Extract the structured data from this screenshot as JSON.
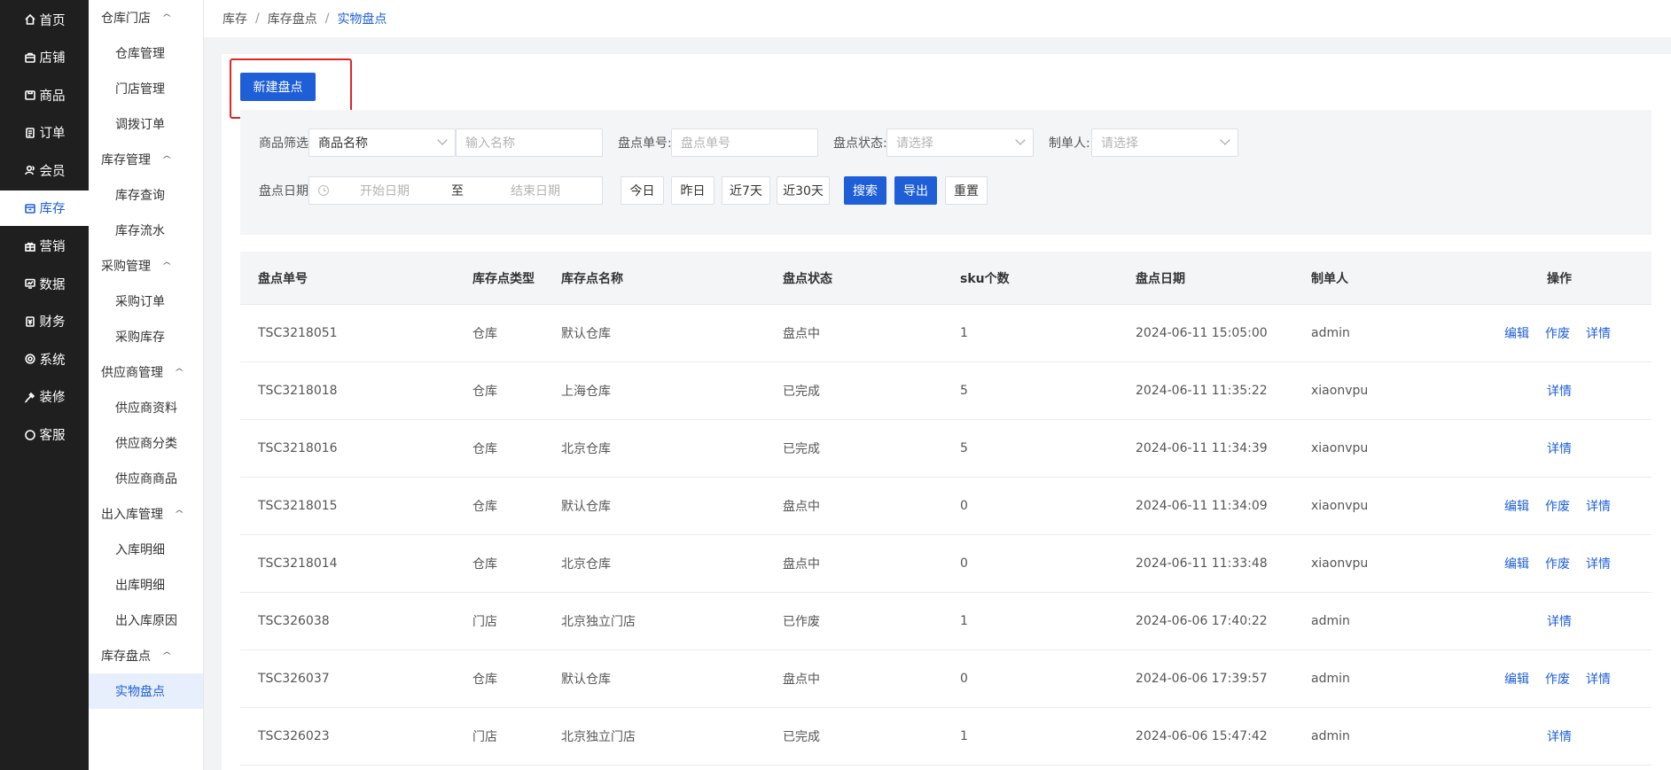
{
  "nav": [
    {
      "label": "首页",
      "icon": "home-icon"
    },
    {
      "label": "店铺",
      "icon": "store-icon"
    },
    {
      "label": "商品",
      "icon": "goods-icon"
    },
    {
      "label": "订单",
      "icon": "order-icon"
    },
    {
      "label": "会员",
      "icon": "member-icon"
    },
    {
      "label": "库存",
      "icon": "inventory-icon",
      "active": true
    },
    {
      "label": "营销",
      "icon": "gift-icon"
    },
    {
      "label": "数据",
      "icon": "chart-icon"
    },
    {
      "label": "财务",
      "icon": "finance-icon"
    },
    {
      "label": "系统",
      "icon": "gear-icon"
    },
    {
      "label": "装修",
      "icon": "decor-icon"
    },
    {
      "label": "客服",
      "icon": "chat-icon"
    }
  ],
  "submenu": [
    {
      "group": "仓库门店",
      "items": [
        "仓库管理",
        "门店管理",
        "调拨订单"
      ]
    },
    {
      "group": "库存管理",
      "items": [
        "库存查询",
        "库存流水"
      ]
    },
    {
      "group": "采购管理",
      "items": [
        "采购订单",
        "采购库存"
      ]
    },
    {
      "group": "供应商管理",
      "items": [
        "供应商资料",
        "供应商分类",
        "供应商商品"
      ]
    },
    {
      "group": "出入库管理",
      "items": [
        "入库明细",
        "出库明细",
        "出入库原因"
      ]
    },
    {
      "group": "库存盘点",
      "items": [
        "实物盘点"
      ]
    }
  ],
  "submenu_active": "实物盘点",
  "breadcrumb": [
    "库存",
    "库存盘点",
    "实物盘点"
  ],
  "new_button": "新建盘点",
  "filters": {
    "goods_label": "商品筛选:",
    "goods_select": "商品名称",
    "goods_input_placeholder": "输入名称",
    "order_no_label": "盘点单号:",
    "order_no_placeholder": "盘点单号",
    "status_label": "盘点状态:",
    "status_placeholder": "请选择",
    "creator_label": "制单人:",
    "creator_placeholder": "请选择",
    "date_label": "盘点日期:",
    "start_placeholder": "开始日期",
    "to": "至",
    "end_placeholder": "结束日期",
    "quick": [
      "今日",
      "昨日",
      "近7天",
      "近30天"
    ],
    "search": "搜索",
    "export": "导出",
    "reset": "重置"
  },
  "table": {
    "columns": [
      "盘点单号",
      "库存点类型",
      "库存点名称",
      "盘点状态",
      "sku个数",
      "盘点日期",
      "制单人",
      "操作"
    ],
    "rows": [
      {
        "no": "TSC3218051",
        "type": "仓库",
        "name": "默认仓库",
        "status": "盘点中",
        "sku": "1",
        "date": "2024-06-11 15:05:00",
        "creator": "admin",
        "ops": [
          "编辑",
          "作废",
          "详情"
        ]
      },
      {
        "no": "TSC3218018",
        "type": "仓库",
        "name": "上海仓库",
        "status": "已完成",
        "sku": "5",
        "date": "2024-06-11 11:35:22",
        "creator": "xiaonvpu",
        "ops": [
          "详情"
        ]
      },
      {
        "no": "TSC3218016",
        "type": "仓库",
        "name": "北京仓库",
        "status": "已完成",
        "sku": "5",
        "date": "2024-06-11 11:34:39",
        "creator": "xiaonvpu",
        "ops": [
          "详情"
        ]
      },
      {
        "no": "TSC3218015",
        "type": "仓库",
        "name": "默认仓库",
        "status": "盘点中",
        "sku": "0",
        "date": "2024-06-11 11:34:09",
        "creator": "xiaonvpu",
        "ops": [
          "编辑",
          "作废",
          "详情"
        ]
      },
      {
        "no": "TSC3218014",
        "type": "仓库",
        "name": "北京仓库",
        "status": "盘点中",
        "sku": "0",
        "date": "2024-06-11 11:33:48",
        "creator": "xiaonvpu",
        "ops": [
          "编辑",
          "作废",
          "详情"
        ]
      },
      {
        "no": "TSC326038",
        "type": "门店",
        "name": "北京独立门店",
        "status": "已作废",
        "sku": "1",
        "date": "2024-06-06 17:40:22",
        "creator": "admin",
        "ops": [
          "详情"
        ]
      },
      {
        "no": "TSC326037",
        "type": "仓库",
        "name": "默认仓库",
        "status": "盘点中",
        "sku": "0",
        "date": "2024-06-06 17:39:57",
        "creator": "admin",
        "ops": [
          "编辑",
          "作废",
          "详情"
        ]
      },
      {
        "no": "TSC326023",
        "type": "门店",
        "name": "北京独立门店",
        "status": "已完成",
        "sku": "1",
        "date": "2024-06-06 15:47:42",
        "creator": "admin",
        "ops": [
          "详情"
        ]
      }
    ]
  },
  "colors": {
    "accent": "#1e5fd8",
    "nav_bg": "#1f1f1f",
    "highlight": "#e02424"
  }
}
